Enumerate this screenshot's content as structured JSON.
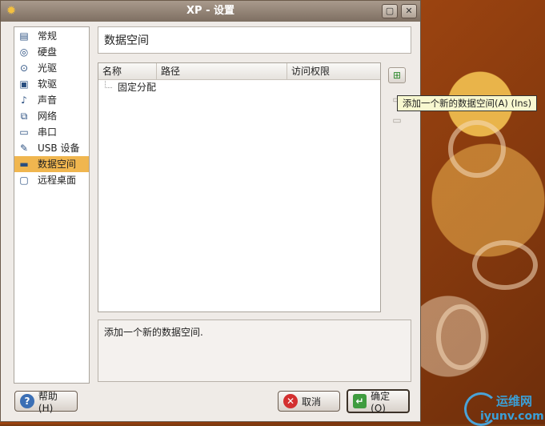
{
  "window": {
    "title": "XP - 设置",
    "minimize_glyph": "▢",
    "close_glyph": "✕"
  },
  "sidebar": {
    "items": [
      {
        "label": "常规",
        "icon": "general-icon"
      },
      {
        "label": "硬盘",
        "icon": "harddisk-icon"
      },
      {
        "label": "光驱",
        "icon": "cdrom-icon"
      },
      {
        "label": "软驱",
        "icon": "floppy-icon"
      },
      {
        "label": "声音",
        "icon": "audio-icon"
      },
      {
        "label": "网络",
        "icon": "network-icon"
      },
      {
        "label": "串口",
        "icon": "serial-port-icon"
      },
      {
        "label": "USB 设备",
        "icon": "usb-icon"
      },
      {
        "label": "数据空间",
        "icon": "folder-icon",
        "selected": true
      },
      {
        "label": "远程桌面",
        "icon": "remote-display-icon"
      }
    ]
  },
  "main": {
    "section_title": "数据空间",
    "table": {
      "columns": [
        "名称",
        "路径",
        "访问权限"
      ],
      "tree_root": "固定分配"
    },
    "tooltip": "添加一个新的数据空间(A) (Ins)",
    "description": "添加一个新的数据空间."
  },
  "buttons": {
    "help": "帮助(H)",
    "cancel": "取消",
    "ok": "确定(O)"
  },
  "watermark": {
    "line1": "运维网",
    "line2": "iyunv.com"
  },
  "colors": {
    "selection": "#f0b64f",
    "titlebar": "#8e7f72"
  }
}
